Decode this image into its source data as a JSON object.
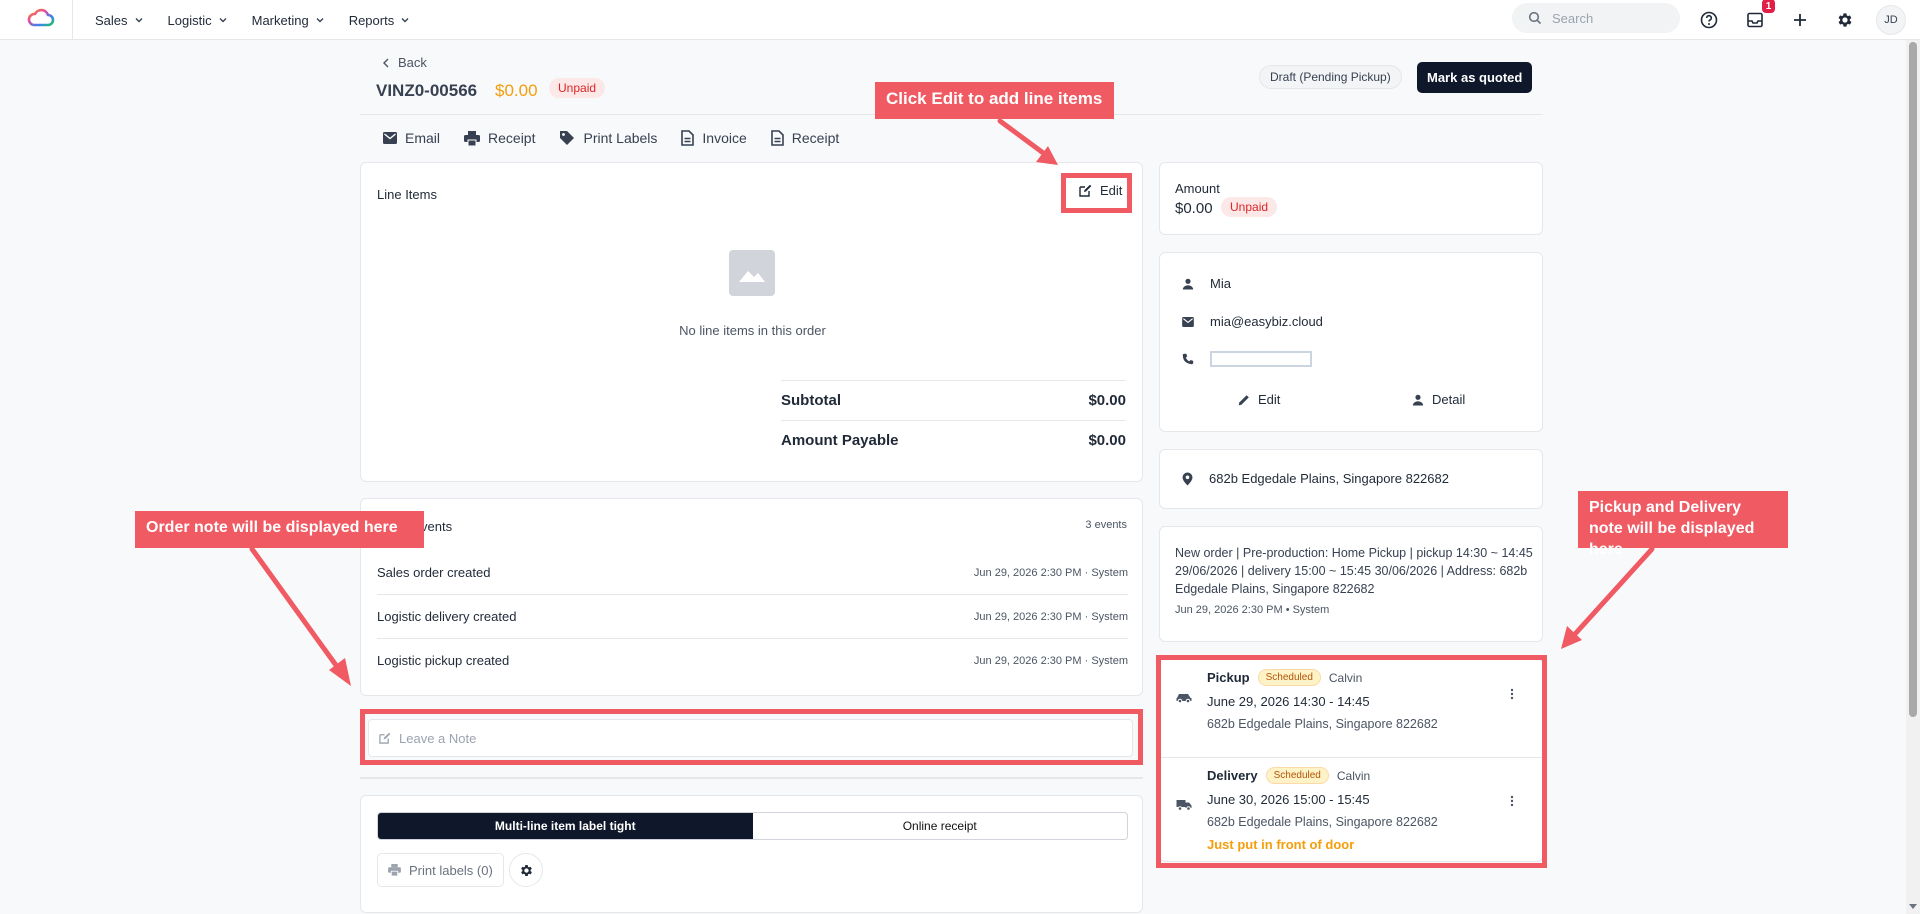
{
  "nav": {
    "menu": [
      {
        "label": "Sales"
      },
      {
        "label": "Logistic"
      },
      {
        "label": "Marketing"
      },
      {
        "label": "Reports"
      }
    ],
    "search_placeholder": "Search",
    "inbox_badge": "1",
    "avatar_initials": "JD"
  },
  "header": {
    "back_label": "Back",
    "order_id": "VINZ0-00566",
    "amount": "$0.00",
    "payment_status": "Unpaid",
    "order_status": "Draft (Pending Pickup)",
    "mark_quoted_label": "Mark as quoted"
  },
  "toolbar": [
    {
      "label": "Email",
      "icon": "mail-icon"
    },
    {
      "label": "Receipt",
      "icon": "printer-icon"
    },
    {
      "label": "Print Labels",
      "icon": "tag-icon"
    },
    {
      "label": "Invoice",
      "icon": "document-icon"
    },
    {
      "label": "Receipt",
      "icon": "document-icon"
    }
  ],
  "line_items": {
    "title": "Line Items",
    "edit_label": "Edit",
    "empty_text": "No line items in this order",
    "subtotal_label": "Subtotal",
    "subtotal_value": "$0.00",
    "payable_label": "Amount Payable",
    "payable_value": "$0.00"
  },
  "events": {
    "title_visible": "vents",
    "count": "3 events",
    "items": [
      {
        "title": "Sales order created",
        "time": "Jun 29, 2026 2:30 PM · System"
      },
      {
        "title": "Logistic delivery created",
        "time": "Jun 29, 2026 2:30 PM · System"
      },
      {
        "title": "Logistic pickup created",
        "time": "Jun 29, 2026 2:30 PM · System"
      }
    ]
  },
  "note": {
    "placeholder": "Leave a Note"
  },
  "print": {
    "tabs": [
      {
        "label": "Multi-line item label tight",
        "active": true
      },
      {
        "label": "Online receipt",
        "active": false
      }
    ],
    "print_labels": "Print labels (0)"
  },
  "amount_card": {
    "label": "Amount",
    "value": "$0.00",
    "status": "Unpaid"
  },
  "contact": {
    "name": "Mia",
    "email": "mia@easybiz.cloud",
    "edit_label": "Edit",
    "detail_label": "Detail"
  },
  "address": "682b Edgedale Plains, Singapore 822682",
  "order_notes": {
    "text": "New order | Pre-production: Home Pickup | pickup 14:30 ~ 14:45 29/06/2026 | delivery 15:00 ~ 15:45 30/06/2026 | Address: 682b Edgedale Plains, Singapore 822682",
    "meta": "Jun 29, 2026 2:30 PM • System"
  },
  "logistics": [
    {
      "type": "Pickup",
      "status": "Scheduled",
      "driver": "Calvin",
      "time": "June 29, 2026 14:30 - 14:45",
      "address": "682b Edgedale Plains, Singapore 822682",
      "note": ""
    },
    {
      "type": "Delivery",
      "status": "Scheduled",
      "driver": "Calvin",
      "time": "June 30, 2026 15:00 - 15:45",
      "address": "682b Edgedale Plains, Singapore 822682",
      "note": "Just put in front of door"
    }
  ],
  "annotations": {
    "edit_callout": "Click Edit to add line items",
    "order_note_callout": "Order note will be displayed here",
    "pickup_callout": "Pickup and Delivery note will be displayed here"
  },
  "colors": {
    "accent_dark": "#0f172a",
    "unpaid_red": "#dc2626",
    "amount_orange": "#f59e0b",
    "annotation_red": "#f05a63"
  }
}
